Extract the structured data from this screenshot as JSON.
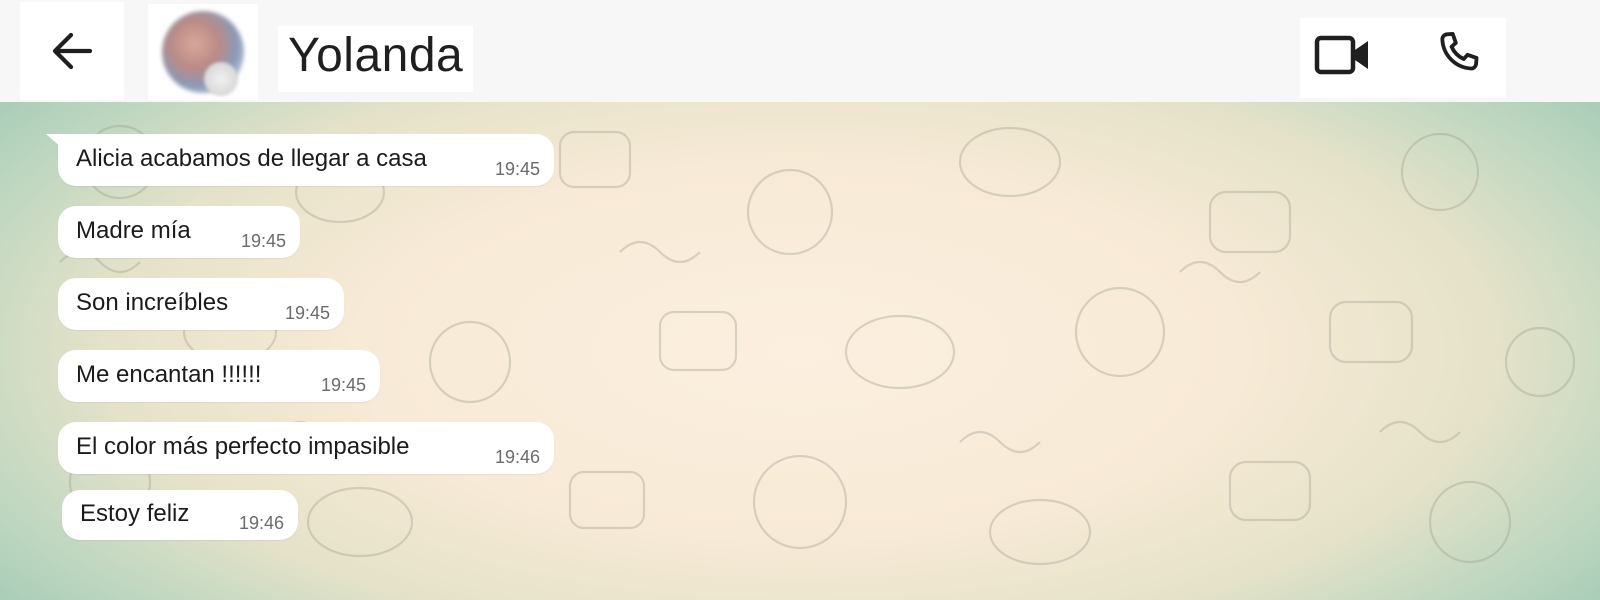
{
  "header": {
    "contact_name": "Yolanda",
    "icons": {
      "back": "arrow-back-icon",
      "video": "video-camera-icon",
      "call": "phone-icon"
    }
  },
  "messages": [
    {
      "text": "Alicia acabamos de llegar a casa",
      "time": "19:45"
    },
    {
      "text": "Madre mía",
      "time": "19:45"
    },
    {
      "text": "Son increíbles",
      "time": "19:45"
    },
    {
      "text": "Me encantan !!!!!!",
      "time": "19:45"
    },
    {
      "text": "El color más perfecto impasible",
      "time": "19:46"
    },
    {
      "text": "Estoy feliz",
      "time": "19:46"
    }
  ],
  "colors": {
    "header_bg": "#f7f7f7",
    "bubble_bg": "#ffffff",
    "chat_center": "#fcefdf",
    "chat_edge": "#a9cdb8",
    "text": "#1b1b1b",
    "time": "#6b6b6b"
  }
}
